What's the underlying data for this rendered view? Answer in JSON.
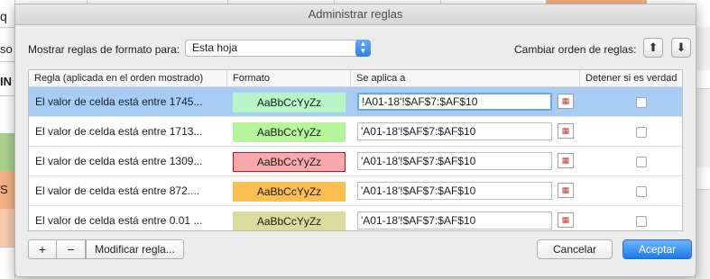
{
  "background_sheet": {
    "visible_fragments": [
      "q",
      "so",
      "IN",
      "S"
    ]
  },
  "dialog": {
    "title": "Administrar reglas",
    "show_rules_label": "Mostrar reglas de formato para:",
    "show_rules_value": "Esta hoja",
    "change_order_label": "Cambiar orden de reglas:",
    "move_up_icon": "arrow-up-icon",
    "move_down_icon": "arrow-down-icon"
  },
  "table": {
    "headers": {
      "rule": "Regla (aplicada en el orden mostrado)",
      "format": "Formato",
      "applies_to": "Se aplica a",
      "stop_if_true": "Detener si es verdad"
    },
    "rows": [
      {
        "rule": "El valor de celda está entre 1745...",
        "format_sample": "AaBbCcYyZz",
        "format_bg": "#b7f5c9",
        "format_border": "#b7f5c9",
        "applies_to": "!A01-18'!$AF$7:$AF$10",
        "stop_if_true": false,
        "selected": true
      },
      {
        "rule": "El valor de celda está entre 1713...",
        "format_sample": "AaBbCcYyZz",
        "format_bg": "#b6f59a",
        "format_border": "#b6f59a",
        "applies_to": "'A01-18'!$AF$7:$AF$10",
        "stop_if_true": false,
        "selected": false
      },
      {
        "rule": "El valor de celda está entre 1309...",
        "format_sample": "AaBbCcYyZz",
        "format_bg": "#f7a9ad",
        "format_border": "#c0141c",
        "applies_to": "'A01-18'!$AF$7:$AF$10",
        "stop_if_true": false,
        "selected": false
      },
      {
        "rule": "El valor de celda está entre 872....",
        "format_sample": "AaBbCcYyZz",
        "format_bg": "#fbbe52",
        "format_border": "#fbbe52",
        "applies_to": "'A01-18'!$AF$7:$AF$10",
        "stop_if_true": false,
        "selected": false
      },
      {
        "rule": "El valor de celda está entre 0.01 ...",
        "format_sample": "AaBbCcYyZz",
        "format_bg": "#d9dc9c",
        "format_border": "#d9dc9c",
        "applies_to": "'A01-18'!$AF$7:$AF$10",
        "stop_if_true": false,
        "selected": false
      }
    ]
  },
  "buttons": {
    "add": "+",
    "remove": "−",
    "edit_rule": "Modificar regla...",
    "cancel": "Cancelar",
    "accept": "Aceptar"
  },
  "colors": {
    "accent": "#1f7ae9",
    "selection": "#a7cdf5"
  }
}
